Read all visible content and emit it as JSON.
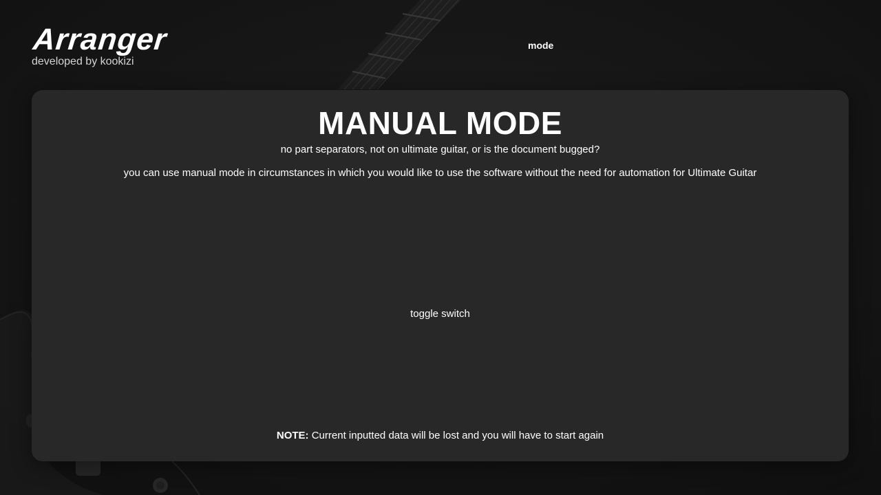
{
  "app": {
    "logo": "Arranger",
    "developer_line": "developed by kookizi"
  },
  "nav": {
    "mode_label": "mode"
  },
  "panel": {
    "title": "MANUAL MODE",
    "question": "no part separators, not on ultimate guitar, or is the document bugged?",
    "description": "you can use manual mode in circumstances in which you would like to use the software without the need for automation for Ultimate Guitar",
    "toggle_label": "toggle switch",
    "note_prefix": "NOTE:",
    "note_text": " Current inputted data will be lost and you will have to start again"
  },
  "background": {
    "image": "guitar-photo",
    "colors": {
      "page": "#161616",
      "panel": "#282828",
      "text": "#ffffff",
      "muted": "#d4d4d4"
    }
  }
}
